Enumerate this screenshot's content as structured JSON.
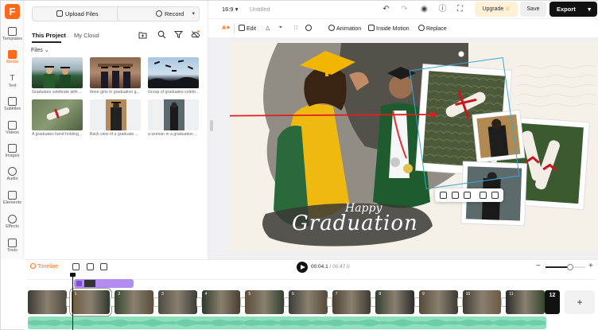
{
  "rail": {
    "items": [
      {
        "label": "Templates"
      },
      {
        "label": "Media"
      },
      {
        "label": "Text"
      },
      {
        "label": "Subtitles"
      },
      {
        "label": "Videos"
      },
      {
        "label": "Images"
      },
      {
        "label": "Audio"
      },
      {
        "label": "Elements"
      },
      {
        "label": "Effects"
      },
      {
        "label": "Tools"
      }
    ],
    "logo": "F"
  },
  "panel": {
    "upload_label": "Upload Files",
    "record_label": "Record",
    "tabs": [
      "This Project",
      "My Cloud"
    ],
    "files_label": "Files",
    "files": [
      {
        "caption": "Graduates celebrate with ..."
      },
      {
        "caption": "three girls in graduation g..."
      },
      {
        "caption": "Group of graduates celebr..."
      },
      {
        "caption": "A graduates hand holding..."
      },
      {
        "caption": "Back view of a graduate ..."
      },
      {
        "caption": "a woman in a graduation ..."
      }
    ]
  },
  "topbar": {
    "ratio": "16:9",
    "title": "Untitled",
    "upgrade": "Upgrade",
    "save": "Save",
    "export": "Export"
  },
  "toolbar": {
    "edit": "Edit",
    "animation": "Animation",
    "inside_motion": "Inside Motion",
    "replace": "Replace"
  },
  "canvas": {
    "script_line1": "Happy",
    "script_line2": "Graduation"
  },
  "timeline": {
    "label": "Timeline",
    "current_time": "00:04.1",
    "total_time": "/ 00:47.0",
    "clip_count": "12",
    "add": "+",
    "zoom_level": 0.62,
    "clip_numbers": [
      "1",
      "2",
      "3",
      "4",
      "5",
      "6",
      "7",
      "8",
      "9",
      "10",
      "11"
    ]
  },
  "colors": {
    "accent": "#ff6a1a",
    "overlay_clip": "#b38cf0",
    "audio_track": "#8ee0bd",
    "export_bg": "#111111",
    "arrow": "#e01e1e"
  }
}
